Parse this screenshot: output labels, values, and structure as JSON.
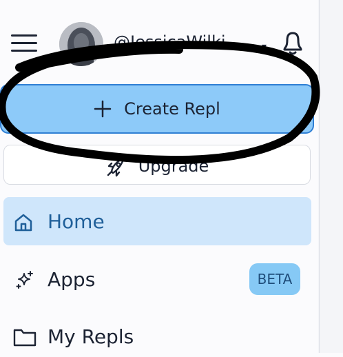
{
  "header": {
    "menu_icon": "hamburger-menu-icon",
    "username": "@JessicaWilki...",
    "notifications_icon": "bell-icon"
  },
  "actions": {
    "create_label": "Create Repl",
    "create_icon": "plus-icon",
    "upgrade_label": "Upgrade",
    "upgrade_icon": "rocket-icon"
  },
  "nav": {
    "items": [
      {
        "label": "Home",
        "icon": "home-icon",
        "active": true
      },
      {
        "label": "Apps",
        "icon": "sparkles-icon",
        "badge": "BETA"
      },
      {
        "label": "My Repls",
        "icon": "folder-icon"
      }
    ]
  },
  "colors": {
    "create_fill": "#8dcaf9",
    "create_border": "#2f7fd4",
    "active_nav": "#cfe6fb",
    "badge": "#86c9f5",
    "annotation": "#000000"
  }
}
